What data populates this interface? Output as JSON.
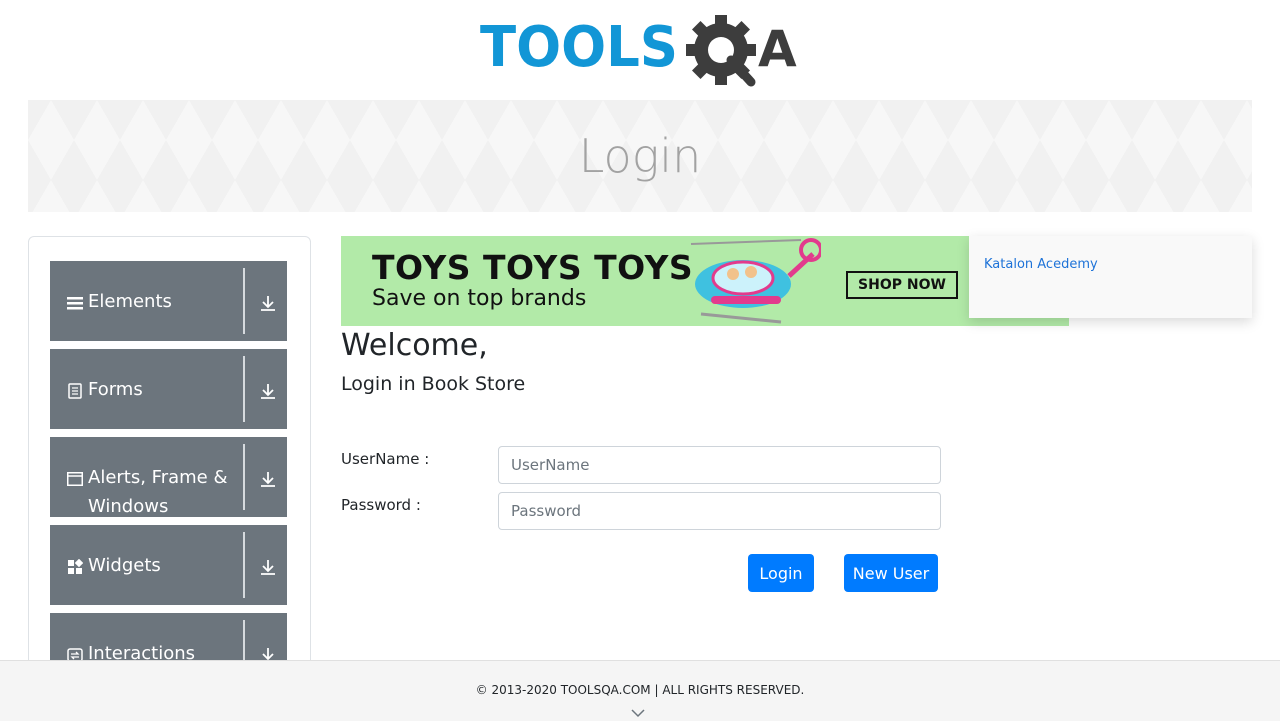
{
  "header": {
    "logo_text_left": "TOOLS",
    "logo_text_right": "QA",
    "logo_colors": {
      "blue": "#1296d6",
      "dark": "#3d3d3d"
    }
  },
  "banner": {
    "title": "Login"
  },
  "sidebar": {
    "groups": [
      {
        "label": "Elements",
        "icon": "list-icon"
      },
      {
        "label": "Forms",
        "icon": "document-icon"
      },
      {
        "label": "Alerts, Frame & Windows",
        "icon": "window-icon"
      },
      {
        "label": "Widgets",
        "icon": "widgets-icon"
      },
      {
        "label": "Interactions",
        "icon": "refresh-icon"
      }
    ],
    "expand_icon": "download-arrow-icon"
  },
  "ad": {
    "headline": "TOYS TOYS TOYS",
    "subline": "Save on top brands",
    "cta": "SHOP NOW",
    "bg_color": "#b2eaa8"
  },
  "popup": {
    "link": "Katalon Acedemy"
  },
  "main": {
    "welcome": "Welcome,",
    "subtitle": "Login in Book Store",
    "username_label": "UserName :",
    "username_placeholder": "UserName",
    "username_value": "",
    "password_label": "Password :",
    "password_placeholder": "Password",
    "password_value": "",
    "login_button": "Login",
    "new_user_button": "New User",
    "accent": "#007bff"
  },
  "footer": {
    "copyright": "© 2013-2020 TOOLSQA.COM | ALL RIGHTS RESERVED."
  }
}
